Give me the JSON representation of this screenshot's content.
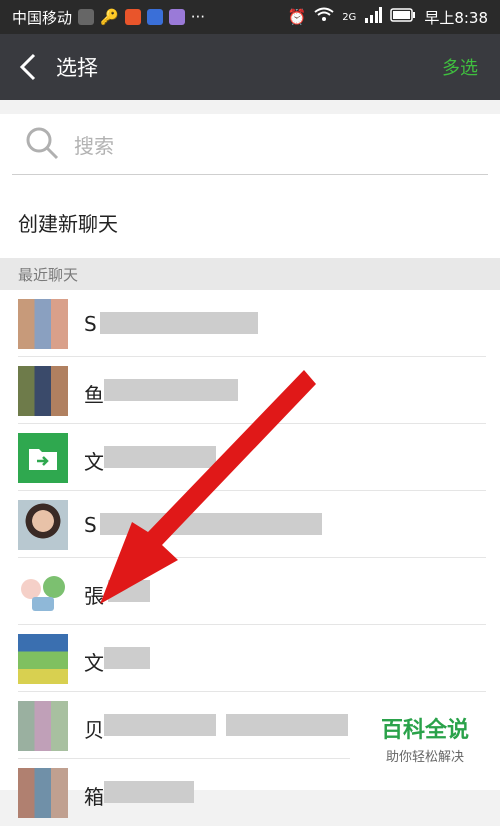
{
  "status_bar": {
    "carrier": "中国移动",
    "time": "早上8:38",
    "network": "2G"
  },
  "header": {
    "title": "选择",
    "action_label": "多选"
  },
  "search": {
    "placeholder": "搜索"
  },
  "new_chat": {
    "label": "创建新聊天"
  },
  "section": {
    "label": "最近聊天"
  },
  "chats": [
    {
      "initial": "S"
    },
    {
      "initial": "鱼"
    },
    {
      "initial": "文"
    },
    {
      "initial": "S"
    },
    {
      "initial": "張"
    },
    {
      "initial": "文"
    },
    {
      "initial": "贝"
    },
    {
      "initial": "箱"
    }
  ],
  "watermark": {
    "title": "百科全说",
    "subtitle": "助你轻松解决"
  },
  "colors": {
    "header_bg": "#393a3f",
    "accent_green": "#3fbf3f",
    "arrow_red": "#e01818"
  }
}
